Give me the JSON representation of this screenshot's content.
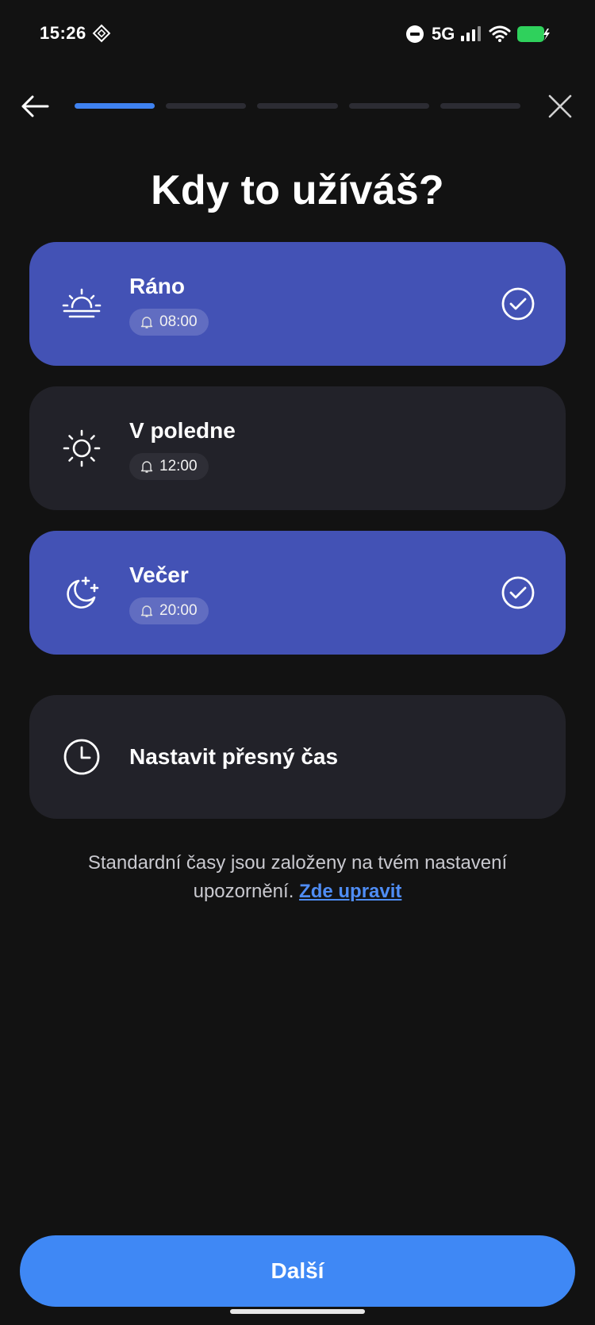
{
  "status_bar": {
    "time": "15:26",
    "network": "5G",
    "icons": [
      "nfc-icon",
      "do-not-disturb-icon",
      "signal-icon",
      "wifi-icon",
      "battery-charging-icon"
    ]
  },
  "header": {
    "back_icon": "arrow-left-icon",
    "close_icon": "close-icon",
    "progress": {
      "current_step": 1,
      "total_steps": 5
    }
  },
  "title": "Kdy to užíváš?",
  "options": [
    {
      "label": "Ráno",
      "time": "08:00",
      "icon": "sunrise-icon",
      "selected": true
    },
    {
      "label": "V poledne",
      "time": "12:00",
      "icon": "sun-icon",
      "selected": false
    },
    {
      "label": "Večer",
      "time": "20:00",
      "icon": "moon-stars-icon",
      "selected": true
    }
  ],
  "custom_time": {
    "label": "Nastavit přesný čas",
    "icon": "clock-icon"
  },
  "footnote": {
    "text": "Standardní časy jsou založeny na tvém nastavení upozornění.",
    "link": "Zde upravit"
  },
  "next_button": "Další",
  "colors": {
    "background": "#121212",
    "card": "#222229",
    "card_selected": "#4352b5",
    "accent": "#3f88f5",
    "link": "#4f8df5"
  }
}
